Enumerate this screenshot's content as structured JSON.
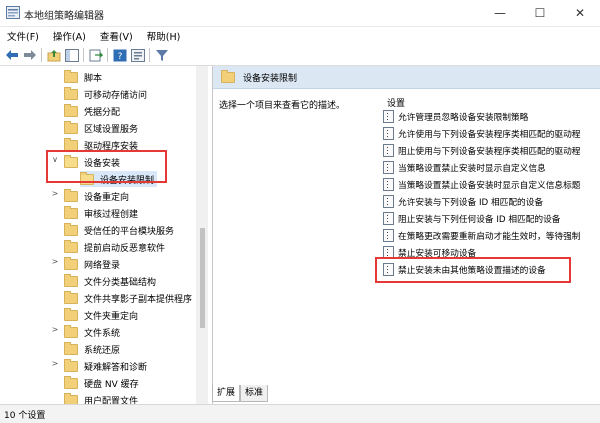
{
  "window": {
    "title": "本地组策略编辑器",
    "controls": [
      "minimize-icon",
      "maximize-icon",
      "close-icon"
    ]
  },
  "menu": [
    "文件(F)",
    "操作(A)",
    "查看(V)",
    "帮助(H)"
  ],
  "toolbar": [
    "back-arrow-icon",
    "forward-arrow-icon",
    "folder-up-icon",
    "tree-view-icon",
    "export-list-icon",
    "help-icon",
    "properties-icon",
    "filter-icon"
  ],
  "tree": {
    "items": [
      {
        "label": "脚本",
        "expander": "",
        "depth": 1
      },
      {
        "label": "可移动存储访问",
        "expander": "",
        "depth": 1
      },
      {
        "label": "凭据分配",
        "expander": "",
        "depth": 1
      },
      {
        "label": "区域设置服务",
        "expander": "",
        "depth": 1
      },
      {
        "label": "驱动程序安装",
        "expander": "",
        "depth": 1
      },
      {
        "label": "设备安装",
        "expander": "∨",
        "depth": 1
      },
      {
        "label": "设备安装限制",
        "expander": "",
        "depth": 2,
        "selected": true
      },
      {
        "label": "设备重定向",
        "expander": ">",
        "depth": 1
      },
      {
        "label": "审核过程创建",
        "expander": "",
        "depth": 1
      },
      {
        "label": "受信任的平台模块服务",
        "expander": "",
        "depth": 1
      },
      {
        "label": "提前启动反恶意软件",
        "expander": "",
        "depth": 1
      },
      {
        "label": "网络登录",
        "expander": ">",
        "depth": 1
      },
      {
        "label": "文件分类基础结构",
        "expander": "",
        "depth": 1
      },
      {
        "label": "文件共享影子副本提供程序",
        "expander": "",
        "depth": 1
      },
      {
        "label": "文件夹重定向",
        "expander": "",
        "depth": 1
      },
      {
        "label": "文件系统",
        "expander": ">",
        "depth": 1
      },
      {
        "label": "系统还原",
        "expander": "",
        "depth": 1
      },
      {
        "label": "疑难解答和诊断",
        "expander": ">",
        "depth": 1
      },
      {
        "label": "硬盘 NV 缓存",
        "expander": "",
        "depth": 1
      },
      {
        "label": "用户配置文件",
        "expander": "",
        "depth": 1
      }
    ]
  },
  "right": {
    "header": "设备安装限制",
    "description": "选择一个项目来查看它的描述。",
    "settings_label": "设置",
    "settings": [
      "允许管理员忽略设备安装限制策略",
      "允许使用与下列设备安装程序类相匹配的驱动程",
      "阻止使用与下列设备安装程序类相匹配的驱动程",
      "当策略设置禁止安装时显示自定义信息",
      "当策略设置禁止设备安装时显示自定义信息标题",
      "允许安装与下列设备 ID 相匹配的设备",
      "阻止安装与下列任何设备 ID 相匹配的设备",
      "在策略更改需要重新启动才能生效时，等待强制",
      "禁止安装可移动设备",
      "禁止安装未由其他策略设置描述的设备"
    ]
  },
  "tabs": [
    "扩展",
    "标准"
  ],
  "status": "10 个设置",
  "highlight_color": "#e53935"
}
